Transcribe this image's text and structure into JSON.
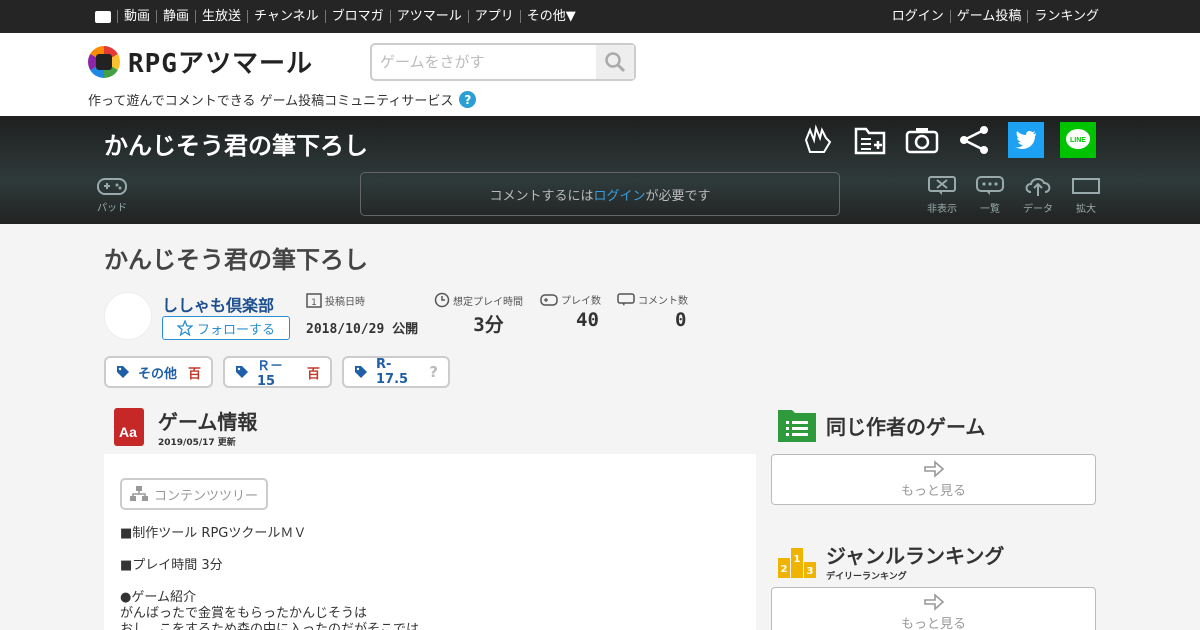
{
  "topnav": {
    "items": [
      "動画",
      "静画",
      "生放送",
      "チャンネル",
      "ブロマガ",
      "アツマール",
      "アプリ",
      "その他▼"
    ],
    "right": [
      "ログイン",
      "ゲーム投稿",
      "ランキング"
    ]
  },
  "header": {
    "logo_text": "RPGアツマール",
    "search_placeholder": "ゲームをさがす",
    "tagline": "作って遊んでコメントできる ゲーム投稿コミュニティサービス",
    "help": "?"
  },
  "gamebar": {
    "title": "かんじそう君の筆下ろし",
    "pad_label": "パッド",
    "comment_prefix": "コメントするには",
    "comment_login": "ログイン",
    "comment_suffix": "が必要です",
    "controls": [
      "非表示",
      "一覧",
      "データ",
      "拡大"
    ],
    "twitter_color": "#1da1f2",
    "line_color": "#00c300",
    "line_label": "LINE"
  },
  "game": {
    "title": "かんじそう君の筆下ろし",
    "author": "ししゃも倶楽部",
    "follow": "フォローする",
    "stats": [
      {
        "label": "投稿日時",
        "value": "2018/10/29 公開"
      },
      {
        "label": "想定プレイ時間",
        "value": "3分"
      },
      {
        "label": "プレイ数",
        "value": "40"
      },
      {
        "label": "コメント数",
        "value": "0"
      }
    ],
    "tags": [
      {
        "label": "その他",
        "mark": "百"
      },
      {
        "label": "Ｒ－15",
        "mark": "百"
      },
      {
        "label": "R-17.5",
        "mark": "?"
      }
    ]
  },
  "info": {
    "heading": "ゲーム情報",
    "updated": "2019/05/17 更新",
    "icon_label": "Aa",
    "tree_button": "コンテンツツリー",
    "description": "■制作ツール RPGツクールＭＶ\n\n■プレイ時間 3分\n\n●ゲーム紹介\nがんばったで金賞をもらったかんじそうは\nおし　こをするため森の中に入ったのだがそこでは"
  },
  "sidebar": {
    "same_author": "同じ作者のゲーム",
    "more": "もっと見る",
    "ranking": "ジャンルランキング",
    "ranking_sub": "デイリーランキング",
    "more2": "もっと見る",
    "rank_icon_text": "213"
  }
}
